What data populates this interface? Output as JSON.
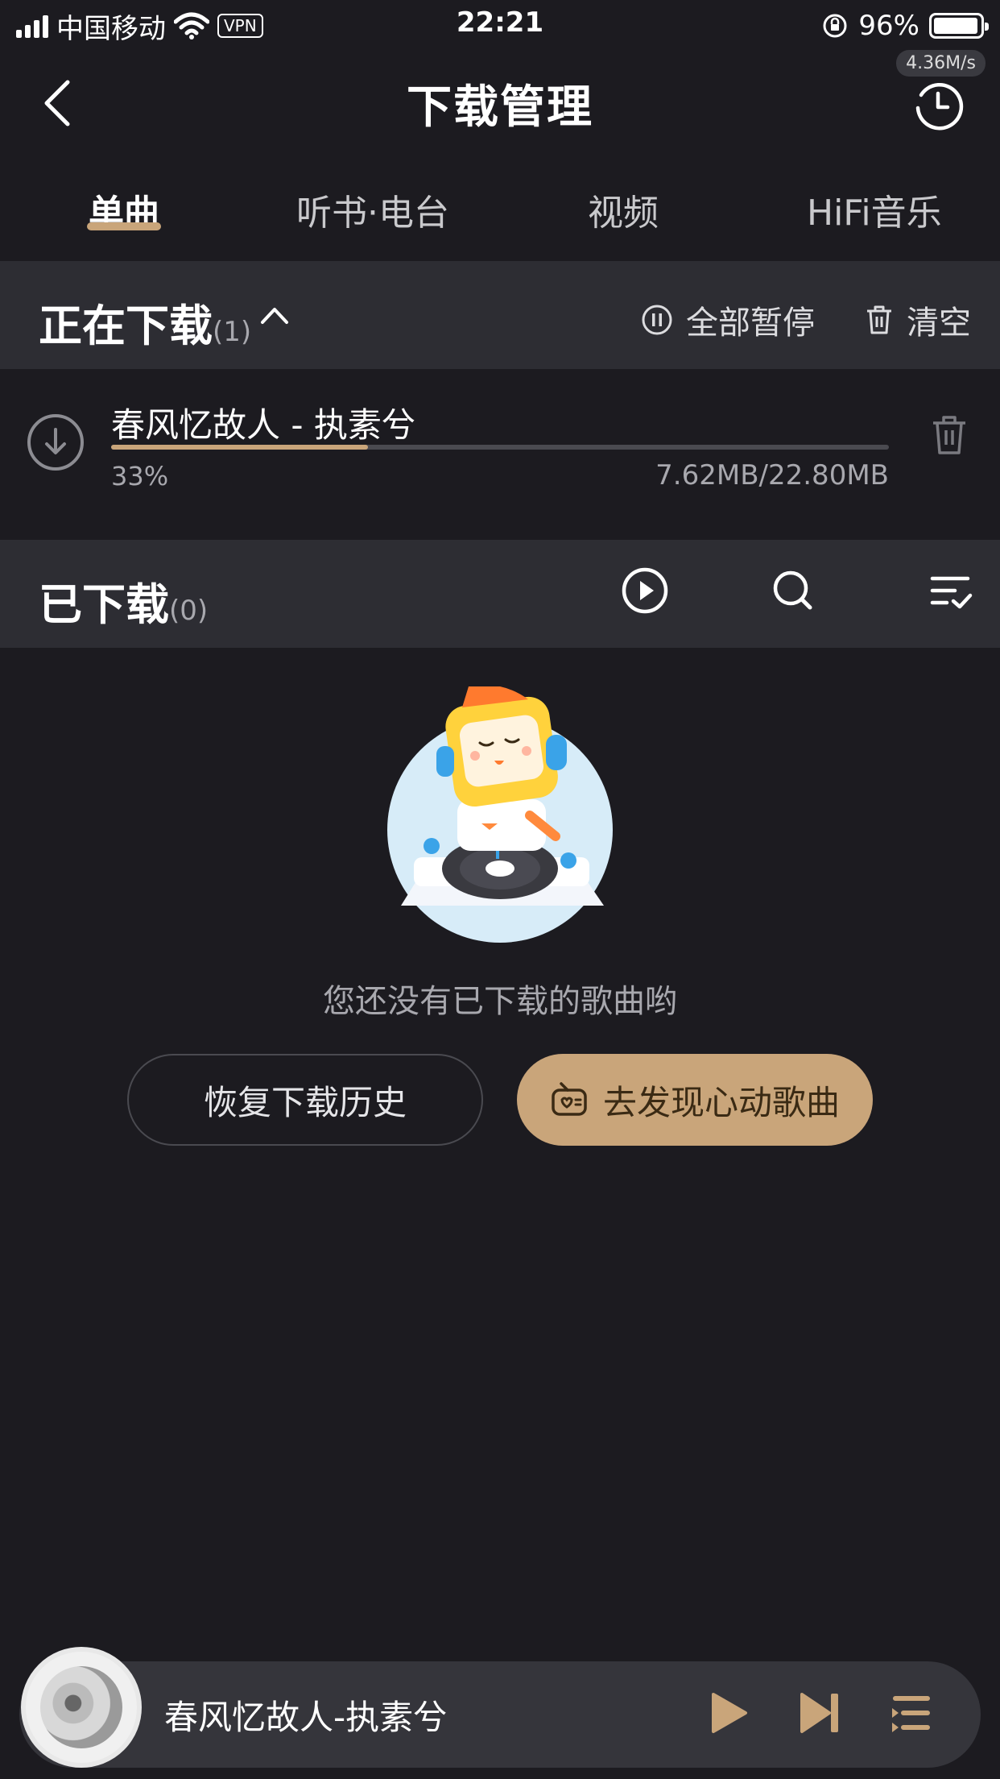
{
  "status_bar": {
    "carrier": "中国移动",
    "vpn": "VPN",
    "time": "22:21",
    "battery": "96%",
    "battery_level": 0.96
  },
  "header": {
    "title": "下载管理",
    "speed": "4.36M/s"
  },
  "tabs": [
    {
      "label": "单曲",
      "active": true
    },
    {
      "label": "听书·电台",
      "active": false
    },
    {
      "label": "视频",
      "active": false
    },
    {
      "label": "HiFi音乐",
      "active": false
    }
  ],
  "downloading": {
    "title": "正在下载",
    "count": "(1)",
    "pause_all": "全部暂停",
    "clear": "清空",
    "items": [
      {
        "title": "春风忆故人 - 执素兮",
        "percent": "33%",
        "progress": 0.33,
        "size": "7.62MB/22.80MB"
      }
    ]
  },
  "downloaded": {
    "title": "已下载",
    "count": "(0)",
    "empty_text": "您还没有已下载的歌曲哟",
    "restore_button": "恢复下载历史",
    "discover_button": "去发现心动歌曲"
  },
  "player": {
    "title": "春风忆故人-执素兮"
  },
  "colors": {
    "background": "#1c1b20",
    "section": "#2d2d33",
    "accent": "#c9a57a"
  }
}
